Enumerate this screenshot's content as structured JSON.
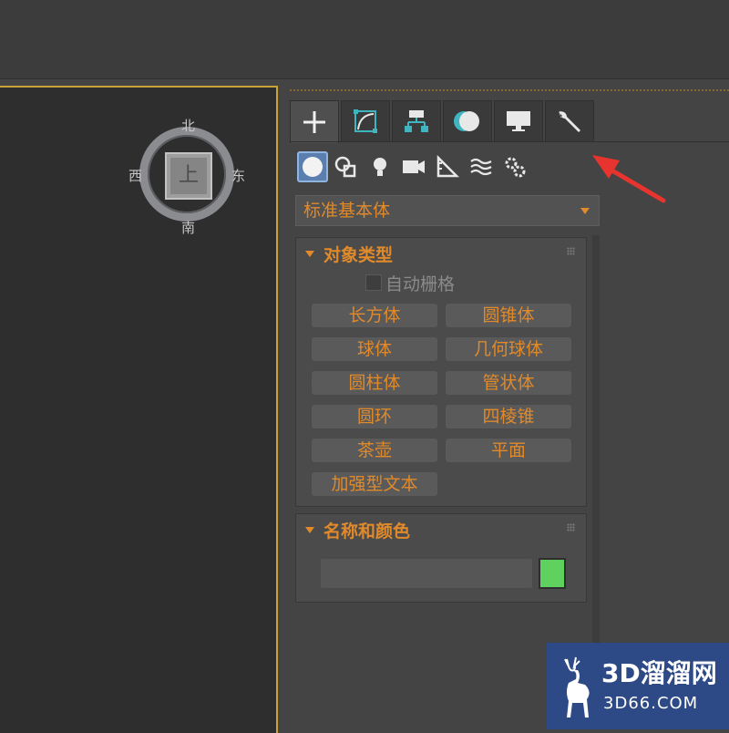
{
  "viewcube": {
    "face": "上",
    "north": "北",
    "south": "南",
    "east": "东",
    "west": "西"
  },
  "command_panel": {
    "tabs": [
      {
        "icon": "plus-icon",
        "active": true
      },
      {
        "icon": "modify-curve-icon",
        "active": false
      },
      {
        "icon": "hierarchy-icon",
        "active": false
      },
      {
        "icon": "motion-circle-icon",
        "active": false
      },
      {
        "icon": "display-monitor-icon",
        "active": false
      },
      {
        "icon": "wrench-icon",
        "active": false
      }
    ],
    "categories": [
      {
        "icon": "geometry-sphere-icon",
        "active": true
      },
      {
        "icon": "shapes-icon",
        "active": false
      },
      {
        "icon": "light-bulb-icon",
        "active": false
      },
      {
        "icon": "camera-icon",
        "active": false
      },
      {
        "icon": "helpers-ruler-icon",
        "active": false
      },
      {
        "icon": "space-warps-icon",
        "active": false
      },
      {
        "icon": "systems-gears-icon",
        "active": false
      }
    ],
    "dropdown_value": "标准基本体",
    "object_type": {
      "title": "对象类型",
      "autogrid_label": "自动栅格",
      "buttons": [
        "长方体",
        "圆锥体",
        "球体",
        "几何球体",
        "圆柱体",
        "管状体",
        "圆环",
        "四棱锥",
        "茶壶",
        "平面",
        "加强型文本"
      ]
    },
    "name_color": {
      "title": "名称和颜色",
      "name_value": "",
      "swatch_color": "#5fd15f"
    }
  },
  "annotation": {
    "color": "#e8342e"
  },
  "watermark": {
    "title": "3D溜溜网",
    "subtitle": "3D66.COM"
  }
}
